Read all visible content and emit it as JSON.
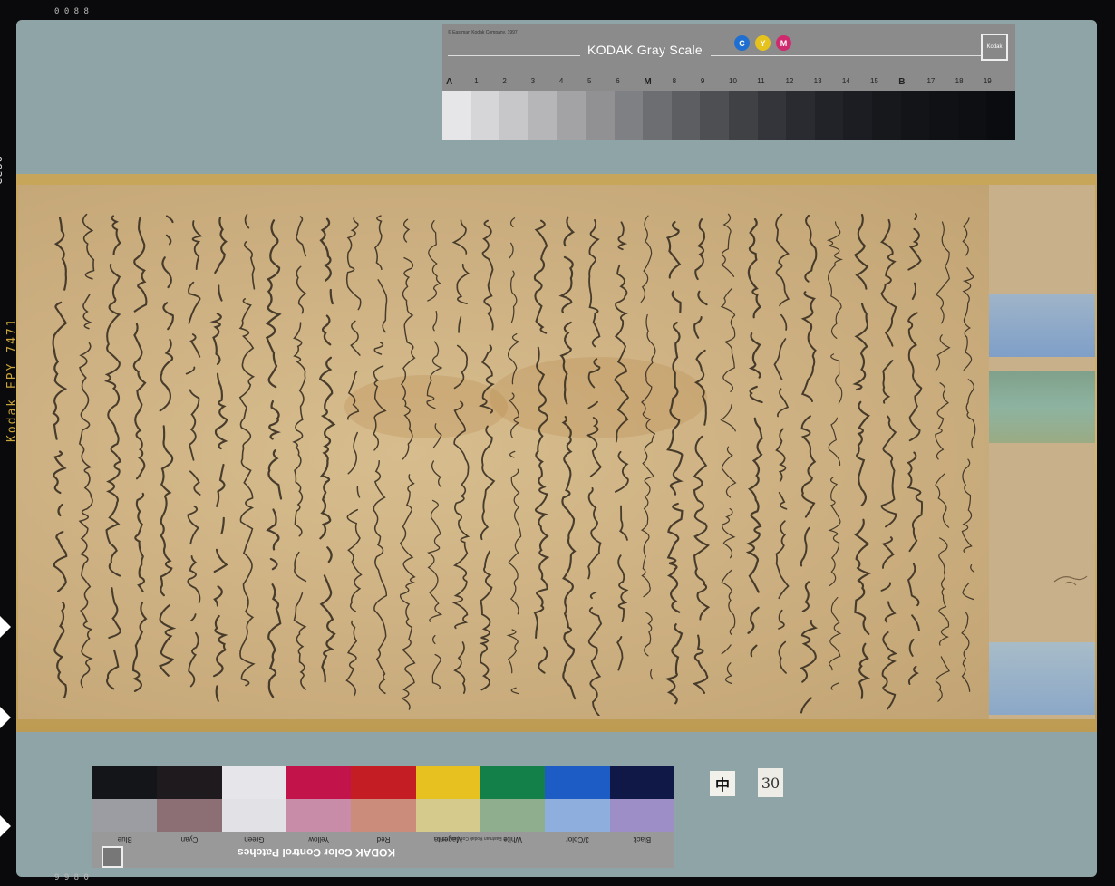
{
  "edge": {
    "main": "Kodak EPY 7471",
    "code": "8832"
  },
  "frame": {
    "top_code": "0 0 8 8",
    "bottom_code": "9 9 8 0"
  },
  "grayscale": {
    "copyright": "© Eastman Kodak Company, 1997",
    "title": "KODAK Gray Scale",
    "cym": [
      "C",
      "Y",
      "M"
    ],
    "logo": "Kodak",
    "scale": [
      "A",
      "1",
      "2",
      "3",
      "4",
      "5",
      "6",
      "M",
      "8",
      "9",
      "10",
      "11",
      "12",
      "13",
      "14",
      "15",
      "B",
      "17",
      "18",
      "19"
    ],
    "patch_colors": [
      "#e6e6e8",
      "#d6d6d8",
      "#c7c7c9",
      "#b6b6b8",
      "#a3a3a6",
      "#919194",
      "#7f8083",
      "#6d6e71",
      "#5d5e61",
      "#4e4f52",
      "#404144",
      "#34353a",
      "#2a2b30",
      "#222328",
      "#1c1d22",
      "#17181c",
      "#131418",
      "#101115",
      "#0e0f12",
      "#0b0c0f"
    ]
  },
  "colorchart": {
    "title": "KODAK Color Control Patches",
    "subtitle": "© Eastman Kodak Company, 1997",
    "labels": [
      "Blue",
      "Cyan",
      "Green",
      "Yellow",
      "Red",
      "Magenta",
      "White",
      "3/Color",
      "Black"
    ],
    "top_colors": [
      "#141518",
      "#1e1a1e",
      "#e5e5ea",
      "#c2134a",
      "#c41e24",
      "#e7c11f",
      "#128048",
      "#1c5cc4",
      "#101848"
    ],
    "bottom_colors": [
      "#9b9da3",
      "#8b6f74",
      "#e2e2e6",
      "#c98ca8",
      "#cc8c7c",
      "#d6c98c",
      "#8fae8d",
      "#8eaede",
      "#9e8ec8"
    ]
  },
  "tags": {
    "naka": "中",
    "number": "30"
  }
}
